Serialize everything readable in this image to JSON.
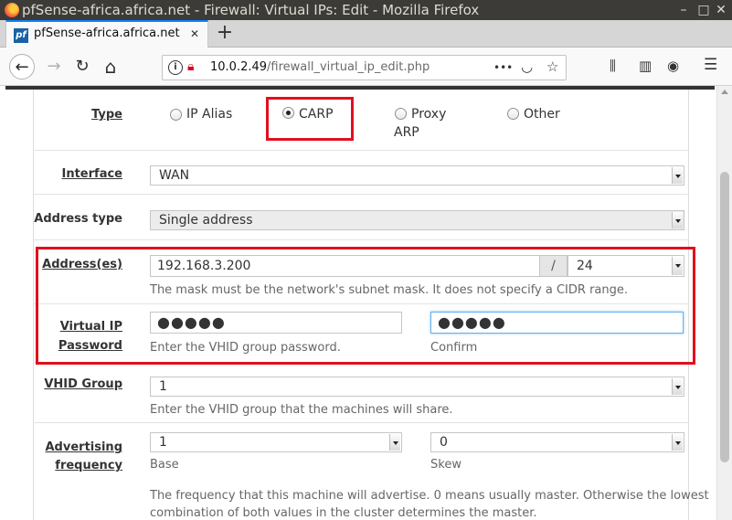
{
  "window": {
    "title": "pfSense-africa.africa.net - Firewall: Virtual IPs: Edit - Mozilla Firefox",
    "minimize_glyph": "–",
    "maximize_glyph": "□",
    "close_glyph": "✕"
  },
  "tab": {
    "favicon_text": "pf",
    "title": "pfSense-africa.africa.net",
    "close_glyph": "✕",
    "new_tab_glyph": "+"
  },
  "nav": {
    "back_glyph": "←",
    "forward_glyph": "→",
    "reload_glyph": "↻",
    "home_glyph": "⌂",
    "url_host": "10.0.2.49",
    "url_path": "/firewall_virtual_ip_edit.php",
    "page_actions_glyph": "•••",
    "pocket_glyph": "◡",
    "bookmark_glyph": "☆",
    "library_glyph": "⫼",
    "sidebar_glyph": "▥",
    "account_glyph": "◉",
    "menu_glyph": "☰"
  },
  "form": {
    "type": {
      "label": "Type",
      "options": [
        {
          "label": "IP Alias",
          "selected": false
        },
        {
          "label": "CARP",
          "selected": true
        },
        {
          "label": "Proxy",
          "label2": "ARP",
          "selected": false
        },
        {
          "label": "Other",
          "selected": false
        }
      ]
    },
    "interface": {
      "label": "Interface",
      "value": "WAN"
    },
    "address_type": {
      "label": "Address type",
      "value": "Single address"
    },
    "addresses": {
      "label": "Address(es)",
      "value": "192.168.3.200",
      "separator": "/",
      "mask": "24",
      "help": "The mask must be the network's subnet mask. It does not specify a CIDR range."
    },
    "vip_password": {
      "label_line1": "Virtual IP",
      "label_line2": "Password",
      "value": "●●●●●",
      "confirm_value": "●●●●●",
      "help": "Enter the VHID group password.",
      "confirm_help": "Confirm"
    },
    "vhid_group": {
      "label": "VHID Group",
      "value": "1",
      "help": "Enter the VHID group that the machines will share."
    },
    "advertising_frequency": {
      "label_line1": "Advertising",
      "label_line2": "frequency",
      "base_value": "1",
      "base_help": "Base",
      "skew_value": "0",
      "skew_help": "Skew",
      "help_line1": "The frequency that this machine will advertise. 0 means usually master. Otherwise the lowest",
      "help_line2": "combination of both values in the cluster determines the master."
    }
  },
  "colors": {
    "highlight": "#e0101e",
    "focus_border": "#66afe9",
    "titlebar": "#3c3b37",
    "tab_accent": "#0a84ff"
  }
}
